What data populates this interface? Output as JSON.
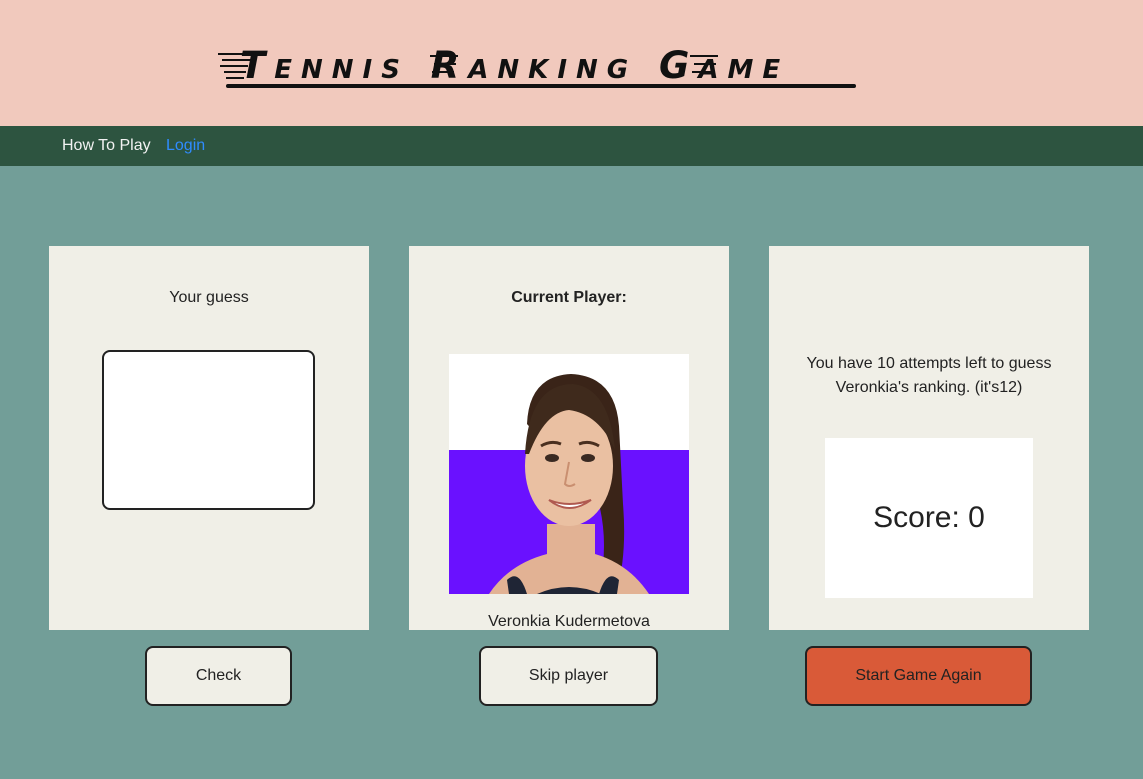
{
  "header": {
    "title": "Tennis Ranking Game"
  },
  "nav": {
    "how_to_play": "How To Play",
    "login": "Login"
  },
  "guess_panel": {
    "label": "Your guess",
    "input_value": ""
  },
  "player_panel": {
    "label": "Current Player:",
    "player_name": "Veronkia Kudermetova"
  },
  "status_panel": {
    "attempts_text": "You have 10 attempts left to guess Veronkia's ranking. (it's12)",
    "score_text": "Score: 0"
  },
  "buttons": {
    "check": "Check",
    "skip": "Skip player",
    "restart": "Start Game Again"
  },
  "colors": {
    "header_bg": "#f1c9bd",
    "nav_bg": "#2d5440",
    "page_bg": "#729e98",
    "panel_bg": "#f0efe7",
    "restart_button": "#d95a38",
    "photo_backdrop": "#6a11ff"
  }
}
